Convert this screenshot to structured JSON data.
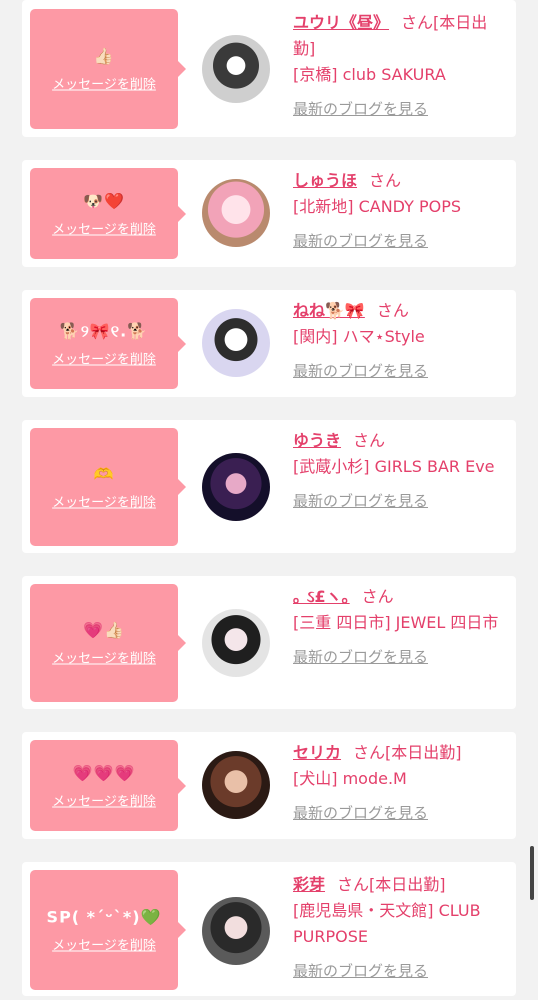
{
  "delete_label": "メッセージを削除",
  "blog_label": "最新のブログを見る",
  "san_label": "さん",
  "entries": [
    {
      "message": "👍🏻",
      "name": "ユウリ《昼》",
      "status": "[本日出勤]",
      "shop": "[京橋] club SAKURA"
    },
    {
      "message": "🐶❤️",
      "name": "しゅうほ",
      "status": "",
      "shop": "[北新地] CANDY POPS"
    },
    {
      "message": "🐕୨🎀୧.🐕",
      "name": "ねね🐕🎀",
      "status": "",
      "shop": "[関内] ハマ⋆Style"
    },
    {
      "message": "🫶",
      "name": "ゆうき",
      "status": "",
      "shop": "[武蔵小杉] GIRLS BAR Eve"
    },
    {
      "message": "💗👍🏻",
      "name": "｡ ઽ£ヽ｡",
      "status": "",
      "shop": "[三重 四日市] JEWEL 四日市"
    },
    {
      "message": "💗💗💗",
      "name": "セリカ",
      "status": "[本日出勤]",
      "shop": "[犬山] mode.M"
    },
    {
      "message": "SP( *´ᵕ`*)💚",
      "name": "彩芽",
      "status": "[本日出勤]",
      "shop": "[鹿児島県・天文館] CLUB PURPOSE"
    }
  ]
}
